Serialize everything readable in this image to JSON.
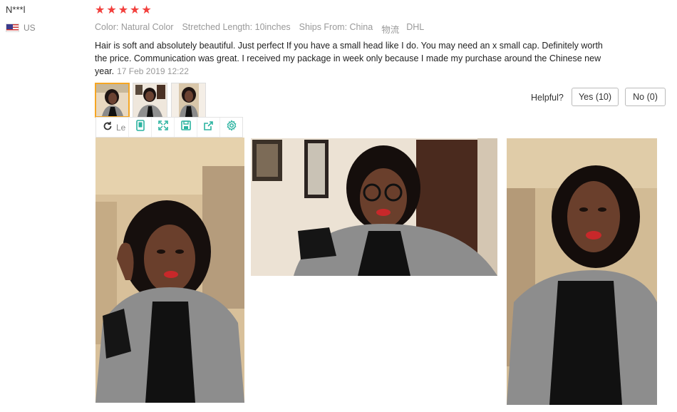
{
  "reviewer": {
    "name": "N***l",
    "country": "US"
  },
  "rating": {
    "stars": 5,
    "max": 5
  },
  "attributes": {
    "color": "Color: Natural Color",
    "length": "Stretched Length: 10inches",
    "ships_from": "Ships From: China",
    "logistics_label": "物流",
    "logistics_value": "DHL"
  },
  "review": {
    "text": "Hair is soft and absolutely beautiful. Just perfect If you have a small head like I do. You may need an x small cap. Definitely worth the price. Communication was great. I received my package in week only because I made my purchase around the Chinese new year.",
    "date": "17 Feb 2019 12:22"
  },
  "helpful": {
    "label": "Helpful?",
    "yes_label": "Yes (10)",
    "no_label": "No (0)"
  },
  "viewer_toolbar": {
    "left_label": "Le",
    "icons": [
      "rotate-icon",
      "phone-frame-icon",
      "expand-icon",
      "save-icon",
      "share-icon",
      "gear-icon"
    ]
  },
  "colors": {
    "star": "#f2403d",
    "active_thumb_border": "#f5a623",
    "toolbar_icon": "#2bb3a0"
  }
}
